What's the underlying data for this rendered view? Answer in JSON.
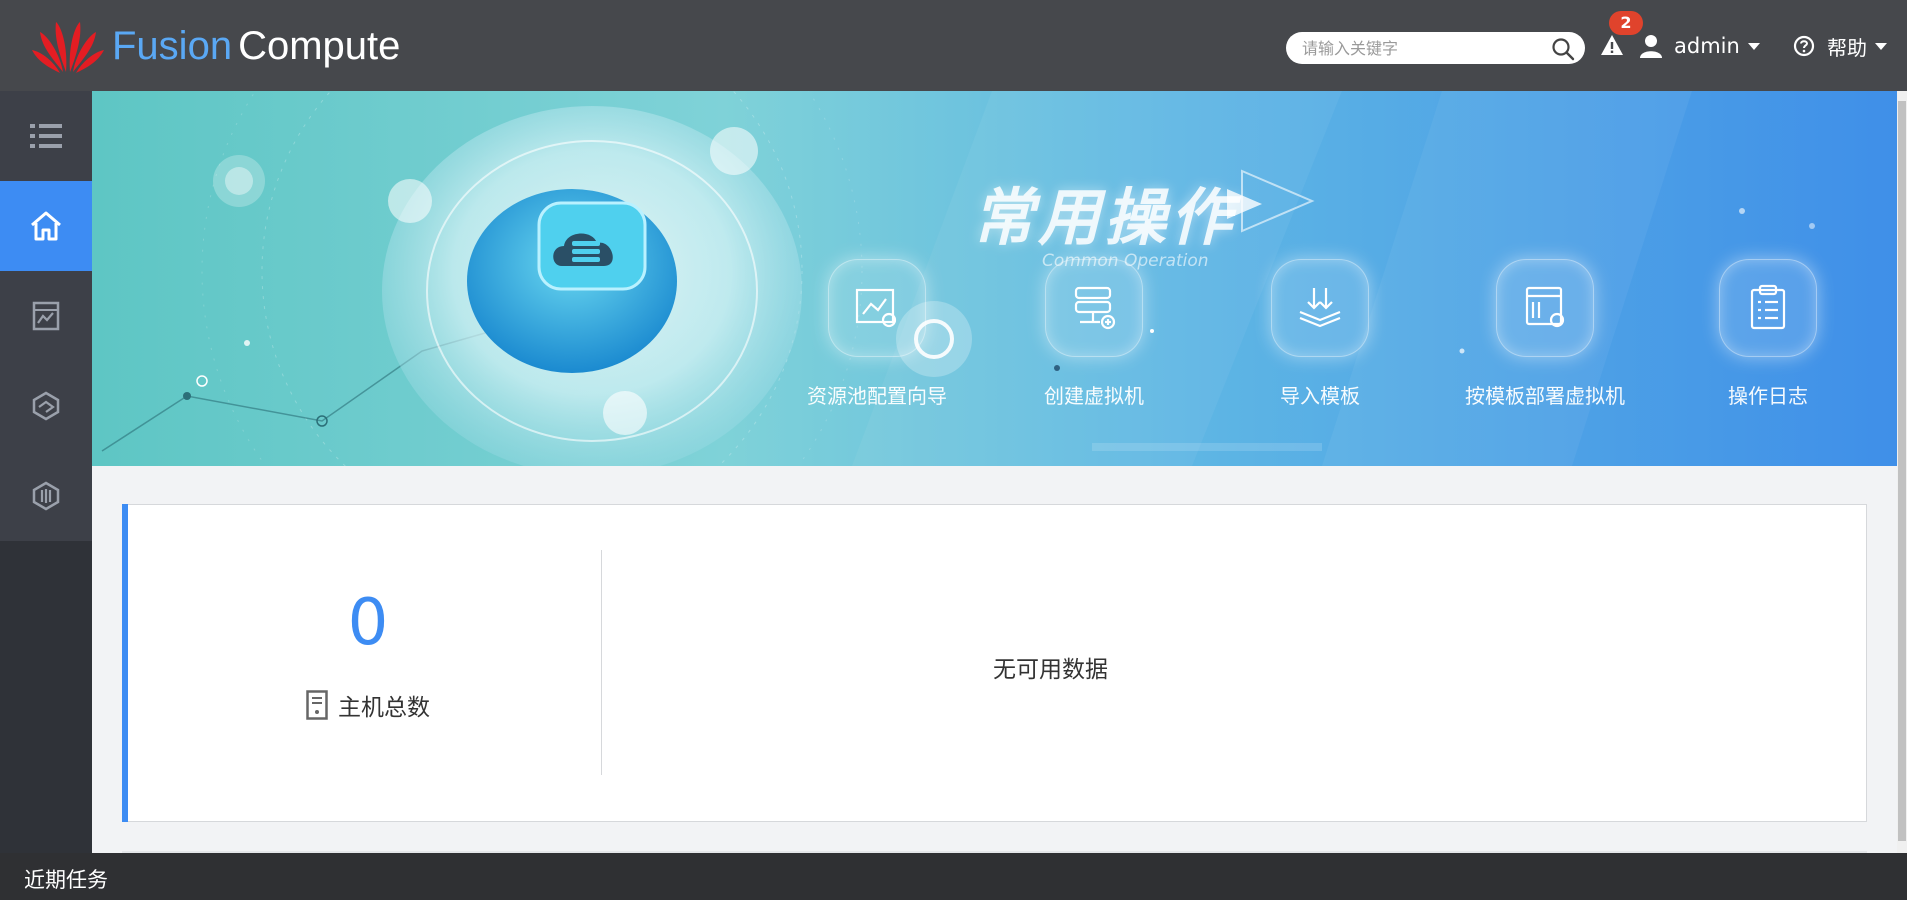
{
  "header": {
    "brand_part1": "Fusion",
    "brand_part2": "Compute",
    "logo_icon": "huawei-petal-logo",
    "search_placeholder": "请输入关键字",
    "alarm_count": "2",
    "user_label": "admin",
    "help_label": "帮助"
  },
  "sidebar": {
    "items": [
      {
        "name": "menu-icon",
        "active": false
      },
      {
        "name": "home-icon",
        "active": true
      },
      {
        "name": "monitor-icon",
        "active": false
      },
      {
        "name": "resource-pool-icon",
        "active": false
      },
      {
        "name": "system-icon",
        "active": false
      }
    ]
  },
  "banner": {
    "title": "常用操作",
    "subtitle": "Common Operation",
    "operations": [
      {
        "label": "资源池配置向导",
        "icon": "config-wizard-icon"
      },
      {
        "label": "创建虚拟机",
        "icon": "create-vm-icon"
      },
      {
        "label": "导入模板",
        "icon": "import-template-icon"
      },
      {
        "label": "按模板部署虚拟机",
        "icon": "deploy-from-template-icon"
      },
      {
        "label": "操作日志",
        "icon": "operation-log-icon"
      }
    ]
  },
  "summary": {
    "host_count": "0",
    "host_label": "主机总数",
    "no_data": "无可用数据"
  },
  "footer": {
    "recent_tasks": "近期任务"
  },
  "colors": {
    "header_bg": "#46484c",
    "accent": "#3d8cf3",
    "alarm_badge": "#e0432c"
  }
}
